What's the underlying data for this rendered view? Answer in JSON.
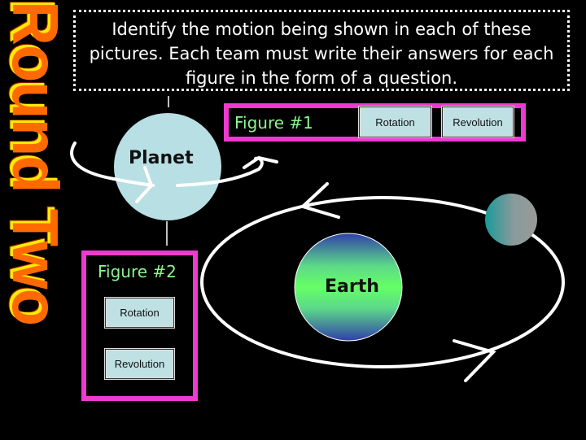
{
  "slide": {
    "round_title": "Round Two",
    "instructions": "Identify the motion being shown in each of these pictures. Each team must write their answers for each figure in the form of a question."
  },
  "figure1": {
    "label": "Figure #1",
    "options": [
      "Rotation",
      "Revolution"
    ],
    "object_label": "Planet"
  },
  "figure2": {
    "label": "Figure #2",
    "options": [
      "Rotation",
      "Revolution"
    ],
    "object_label": "Earth"
  },
  "colors": {
    "title_orange": "#ff6a00",
    "title_shadow": "#ffea00",
    "box_pink": "#ee3ad0",
    "label_green": "#8ef58e",
    "button_fill": "#bfe1e4",
    "planet_fill": "#b8dfe3"
  }
}
